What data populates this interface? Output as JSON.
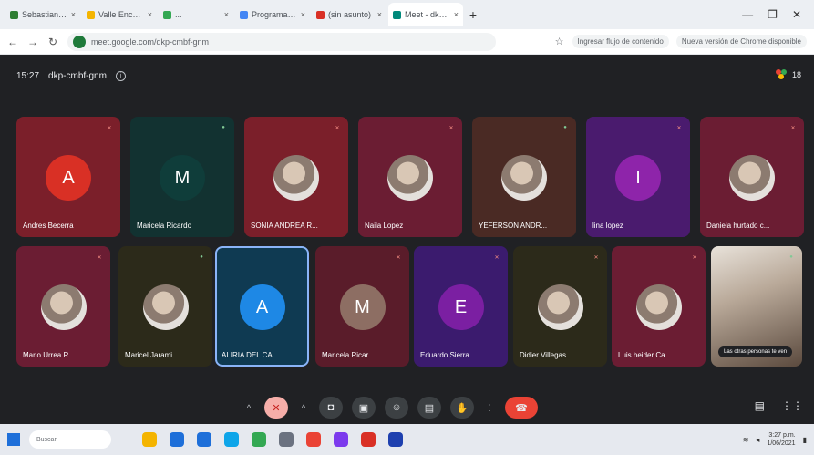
{
  "browser": {
    "tabs": [
      {
        "title": "Sebastian Vela",
        "favicon_color": "#2e7d32",
        "active": false
      },
      {
        "title": "Valle Encuentro",
        "favicon_color": "#f4b400",
        "active": false
      },
      {
        "title": "...",
        "favicon_color": "#34a853",
        "active": false
      },
      {
        "title": "Programa de salud",
        "favicon_color": "#4285f4",
        "active": false
      },
      {
        "title": "(sin asunto)",
        "favicon_color": "#d93025",
        "active": false
      },
      {
        "title": "Meet - dkp-cm",
        "favicon_color": "#00897b",
        "active": true
      }
    ],
    "new_tab_icon": "plus-icon",
    "window_controls": [
      "minimize-icon",
      "restore-icon",
      "close-icon"
    ],
    "url": "meet.google.com/dkp-cmbf-gnm",
    "right_pill_1": "Ingresar flujo de contenido",
    "right_pill_2": "Nueva versión de Chrome disponible"
  },
  "meeting": {
    "time": "15:27",
    "code": "dkp-cmbf-gnm",
    "participant_count": "18",
    "participants": [
      {
        "name": "Andres Becerra",
        "initial": "A",
        "bg": "#7b1f2a",
        "avatar_color": "#d93025",
        "photo": false,
        "mic": "muted"
      },
      {
        "name": "Maricela Ricardo",
        "initial": "M",
        "bg": "#123231",
        "avatar_color": "#0f3d3a",
        "photo": false,
        "mic": "active"
      },
      {
        "name": "SONIA ANDREA R...",
        "initial": "",
        "bg": "#7b1f2a",
        "avatar_color": "",
        "photo": true,
        "mic": "muted"
      },
      {
        "name": "Naila Lopez",
        "initial": "",
        "bg": "#6b1d33",
        "avatar_color": "",
        "photo": true,
        "mic": "muted"
      },
      {
        "name": "YEFERSON ANDR...",
        "initial": "",
        "bg": "#4a2a24",
        "avatar_color": "",
        "photo": true,
        "mic": "active"
      },
      {
        "name": "lina lopez",
        "initial": "I",
        "bg": "#4a1b6e",
        "avatar_color": "#8e24aa",
        "photo": false,
        "mic": "muted"
      },
      {
        "name": "Daniela hurtado c...",
        "initial": "",
        "bg": "#6b1d33",
        "avatar_color": "",
        "photo": true,
        "mic": "muted"
      },
      {
        "name": "Mario Urrea R.",
        "initial": "",
        "bg": "#6b1d33",
        "avatar_color": "",
        "photo": true,
        "mic": "muted"
      },
      {
        "name": "Maricel Jarami...",
        "initial": "",
        "bg": "#2c2a1a",
        "avatar_color": "",
        "photo": true,
        "mic": "active"
      },
      {
        "name": "ALIRIA DEL CA...",
        "initial": "A",
        "bg": "#0f3a52",
        "avatar_color": "#1e88e5",
        "photo": false,
        "mic": "none"
      },
      {
        "name": "Maricela Ricar...",
        "initial": "M",
        "bg": "#5a1c2a",
        "avatar_color": "#8d6e63",
        "photo": false,
        "mic": "muted"
      },
      {
        "name": "Eduardo Sierra",
        "initial": "E",
        "bg": "#3b1b6e",
        "avatar_color": "#7b1fa2",
        "photo": false,
        "mic": "muted"
      },
      {
        "name": "Didier Villegas",
        "initial": "",
        "bg": "#2c2a1a",
        "avatar_color": "",
        "photo": true,
        "mic": "muted"
      },
      {
        "name": "Luis heider Ca...",
        "initial": "",
        "bg": "#6b1d33",
        "avatar_color": "",
        "photo": true,
        "mic": "muted"
      },
      {
        "name": "",
        "initial": "",
        "bg": "#7a6a5c",
        "avatar_color": "",
        "photo": false,
        "mic": "active",
        "video": true
      }
    ],
    "self_view_caption": "Las otras personas te ven"
  },
  "toolbar": {
    "buttons": [
      "chevron-up-icon",
      "mic-off-icon",
      "chevron-up-icon",
      "camera-icon",
      "present-icon",
      "emoji-icon",
      "captions-icon",
      "raise-hand-icon",
      "more-options-icon",
      "end-call-icon"
    ],
    "right": [
      "info-icon",
      "participants-icon"
    ]
  },
  "taskbar": {
    "search_placeholder": "Buscar",
    "apps": [
      "#f4b400",
      "#1e6fd9",
      "#1e6fd9",
      "#0ea5e9",
      "#34a853",
      "#6b7280",
      "#ea4335",
      "#7c3aed",
      "#d93025",
      "#1e40af"
    ],
    "time": "3:27 p.m.",
    "date": "1/06/2021"
  }
}
